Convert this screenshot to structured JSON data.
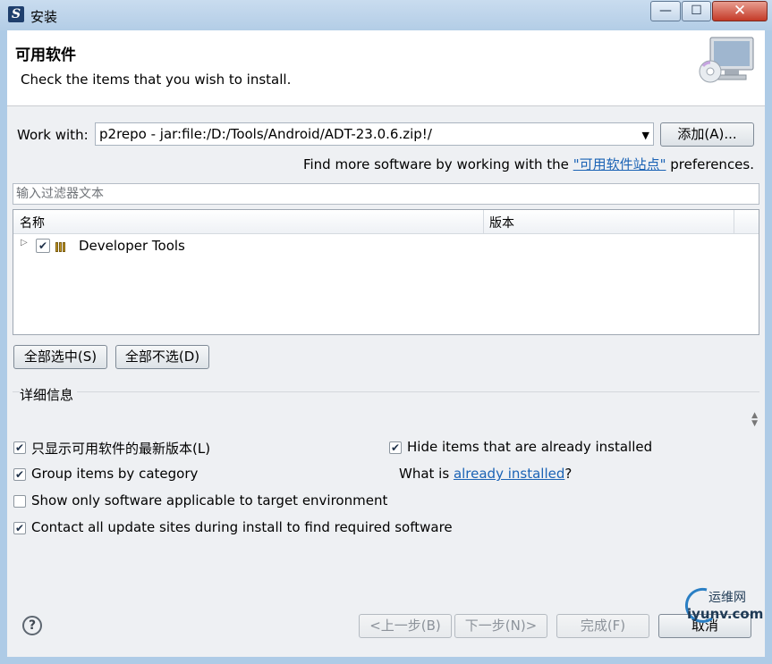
{
  "window": {
    "title": "安装",
    "app_icon_letter": "S",
    "minimize": "—",
    "maximize": "☐",
    "close": "✕"
  },
  "header": {
    "title": "可用软件",
    "description": "Check the items that you wish to install."
  },
  "work_with": {
    "label": "Work with:",
    "value": "p2repo - jar:file:/D:/Tools/Android/ADT-23.0.6.zip!/",
    "add_button": "添加(A)...",
    "find_more_prefix": "Find more software by working with the ",
    "find_more_link": "\"可用软件站点\"",
    "find_more_suffix": " preferences."
  },
  "filter": {
    "placeholder": "输入过滤器文本"
  },
  "tree": {
    "columns": [
      "名称",
      "版本"
    ],
    "rows": [
      {
        "label": "Developer Tools",
        "version": "",
        "checked": true
      }
    ]
  },
  "selection_buttons": {
    "select_all": "全部选中(S)",
    "deselect_all": "全部不选(D)"
  },
  "details": {
    "label": "详细信息"
  },
  "options": {
    "latest_only": {
      "label": "只显示可用软件的最新版本(L)",
      "checked": true
    },
    "hide_installed": {
      "label": "Hide items that are already installed",
      "checked": true
    },
    "group_by_category": {
      "label": "Group items by category",
      "checked": true
    },
    "what_is_prefix": "What is ",
    "what_is_link": "already installed",
    "what_is_suffix": "?",
    "target_env": {
      "label": "Show only software applicable to target environment",
      "checked": false
    },
    "contact_sites": {
      "label": "Contact all update sites during install to find required software",
      "checked": true
    }
  },
  "footer": {
    "help": "?",
    "back": "<上一步(B)",
    "next": "下一步(N)>",
    "finish": "完成(F)",
    "cancel": "取消"
  },
  "watermark": {
    "line1": "运维网",
    "line2": "iyunv.com"
  }
}
